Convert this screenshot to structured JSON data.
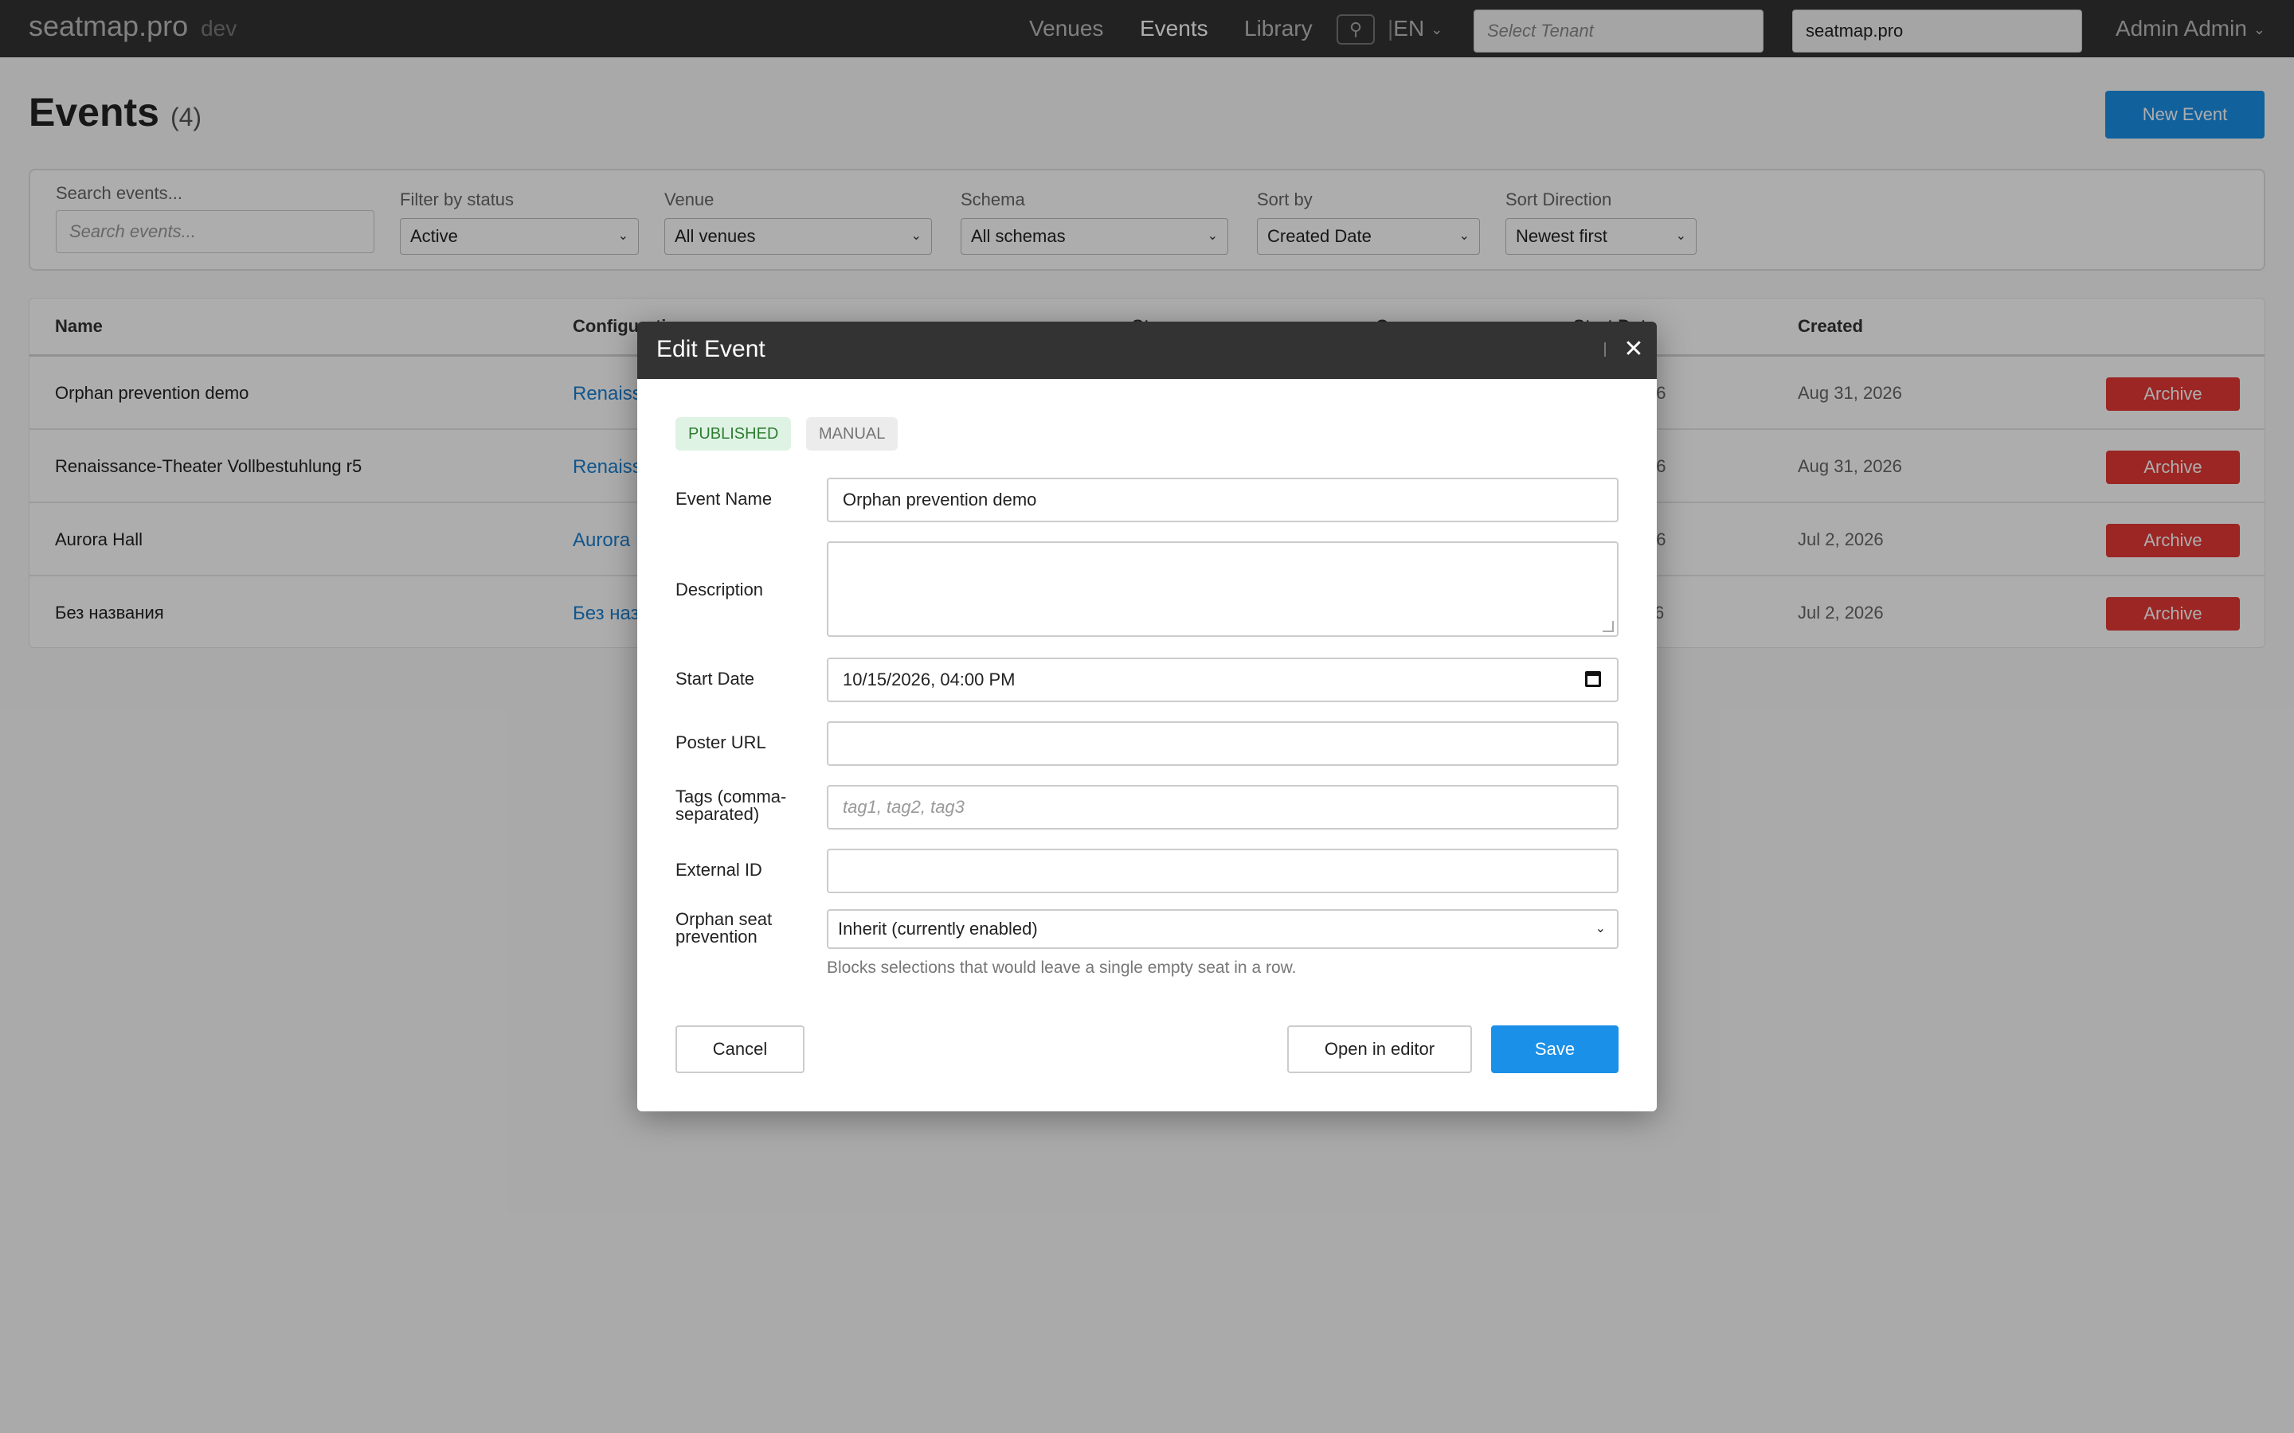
{
  "topbar": {
    "brand": "seatmap.pro",
    "env": "dev",
    "nav": [
      "Venues",
      "Events",
      "Library"
    ],
    "active_nav": "Events",
    "pin_icon": "map-pin-icon",
    "language": "EN",
    "tenant_placeholder": "Select Tenant",
    "domain_value": "seatmap.pro",
    "user": "Admin Admin"
  },
  "page": {
    "title": "Events",
    "count": "(4)",
    "new_event_label": "New Event"
  },
  "filters": {
    "search_label": "Search events...",
    "search_placeholder": "Search events...",
    "status_label": "Filter by status",
    "status_value": "Active",
    "venue_label": "Venue",
    "venue_value": "All venues",
    "schema_label": "Schema",
    "schema_value": "All schemas",
    "sort_label": "Sort by",
    "sort_value": "Created Date",
    "direction_label": "Sort Direction",
    "direction_value": "Newest first"
  },
  "table": {
    "headers": {
      "name": "Name",
      "configuration": "Configurati",
      "status": "St",
      "count": "C",
      "start_date": "Start Dat",
      "created": "Created"
    },
    "rows": [
      {
        "name": "Orphan prevention demo",
        "configuration": "Renaiss",
        "start": "26",
        "created": "Aug 31, 2026",
        "action": "Archive"
      },
      {
        "name": "Renaissance-Theater Vollbestuhlung r5",
        "configuration": "Renaiss",
        "start": "26",
        "created": "Aug 31, 2026",
        "action": "Archive"
      },
      {
        "name": "Aurora Hall",
        "configuration": "Aurora I",
        "start": "26",
        "created": "Jul 2, 2026",
        "action": "Archive"
      },
      {
        "name": "Без названия",
        "configuration": "Без наз",
        "start": "6",
        "created": "Jul 2, 2026",
        "action": "Archive"
      }
    ]
  },
  "modal": {
    "title": "Edit Event",
    "badge_status": "PUBLISHED",
    "badge_mode": "MANUAL",
    "event_name_label": "Event Name",
    "event_name_value": "Orphan prevention demo",
    "description_label": "Description",
    "description_value": "",
    "start_date_label": "Start Date",
    "start_date_value": "10/15/2026, 04:00 PM",
    "poster_label": "Poster URL",
    "poster_value": "",
    "tags_label_1": "Tags (comma-",
    "tags_label_2": "separated)",
    "tags_placeholder": "tag1, tag2, tag3",
    "external_label": "External ID",
    "external_value": "",
    "orphan_label_1": "Orphan seat",
    "orphan_label_2": "prevention",
    "orphan_value": "Inherit (currently enabled)",
    "orphan_hint": "Blocks selections that would leave a single empty seat in a row.",
    "cancel_label": "Cancel",
    "open_editor_label": "Open in editor",
    "save_label": "Save"
  },
  "colors": {
    "topbar": "#333333",
    "primary": "#1a90e8",
    "danger": "#e53935",
    "link": "#1a7fd0",
    "published_bg": "#dff3e4",
    "published_fg": "#2e7d32"
  }
}
